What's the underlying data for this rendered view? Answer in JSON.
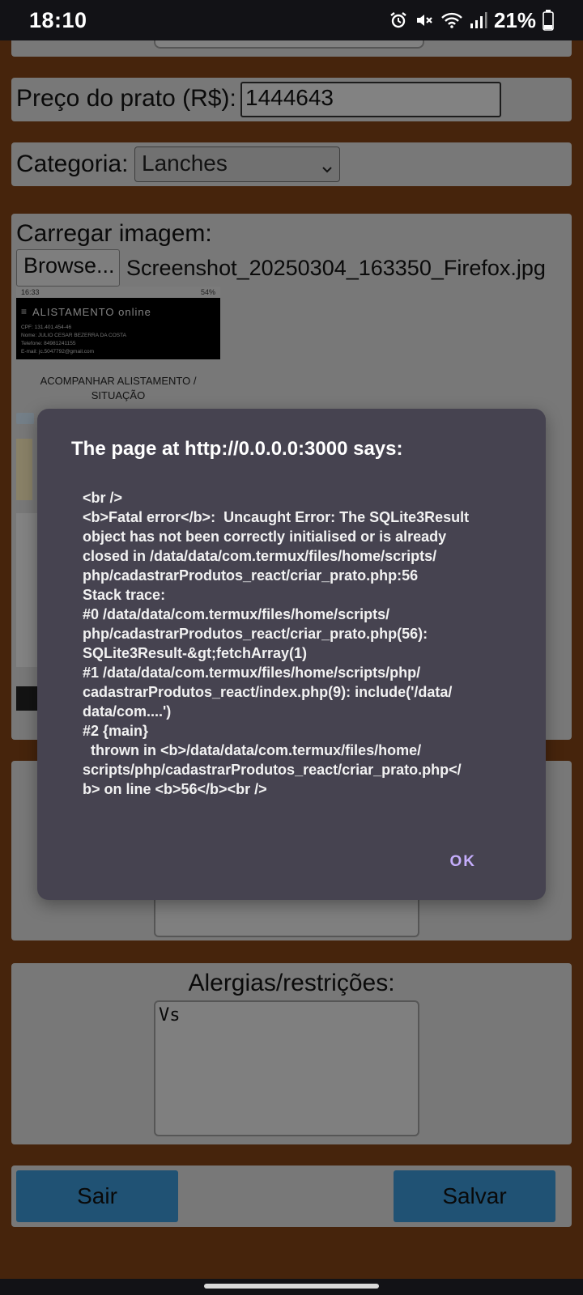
{
  "status_bar": {
    "time": "18:10",
    "battery": "21%",
    "icons": [
      "alarm-icon",
      "mute-icon",
      "wifi-icon",
      "signal-icon",
      "battery-icon"
    ]
  },
  "form": {
    "price_label": "Preço do prato (R$):",
    "price_value": "1444643",
    "category_label": "Categoria:",
    "category_selected": "Lanches",
    "image_label": "Carregar imagem:",
    "browse_label": "Browse...",
    "file_name": "Screenshot_20250304_163350_Firefox.jpg",
    "allergies_label": "Alergias/restrições:",
    "allergies_value": "Vs"
  },
  "preview": {
    "status_time": "16:33",
    "status_right": "54%",
    "brand": "ALISTAMENTO online",
    "lines": [
      "CPF: 131.401.454-46",
      "Nome: JULIO CESAR BEZERRA DA COSTA",
      "Telefone: 84981241155",
      "E-mail: jc.5047792@gmail.com"
    ],
    "caption": "ACOMPANHAR ALISTAMENTO / SITUAÇÃO"
  },
  "actions": {
    "exit_label": "Sair",
    "save_label": "Salvar"
  },
  "dialog": {
    "title": "The page at http://0.0.0.0:3000 says:",
    "message": "<br />\n<b>Fatal error</b>:  Uncaught Error: The SQLite3Result object has not been correctly initialised or is already closed in /data/data/com.termux/files/home/scripts/\nphp/cadastrarProdutos_react/criar_prato.php:56\nStack trace:\n#0 /data/data/com.termux/files/home/scripts/\nphp/cadastrarProdutos_react/criar_prato.php(56):\nSQLite3Result-&gt;fetchArray(1)\n#1 /data/data/com.termux/files/home/scripts/php/\ncadastrarProdutos_react/index.php(9): include('/data/\ndata/com....')\n#2 {main}\n  thrown in <b>/data/data/com.termux/files/home/\nscripts/php/cadastrarProdutos_react/criar_prato.php</\nb> on line <b>56</b><br />",
    "ok_label": "OK"
  },
  "colors": {
    "page_background": "#7e4117",
    "panel": "#d6d6d6",
    "button_blue": "#3a93cf",
    "dialog_background": "#464350",
    "dialog_ok": "#c5aefc"
  }
}
